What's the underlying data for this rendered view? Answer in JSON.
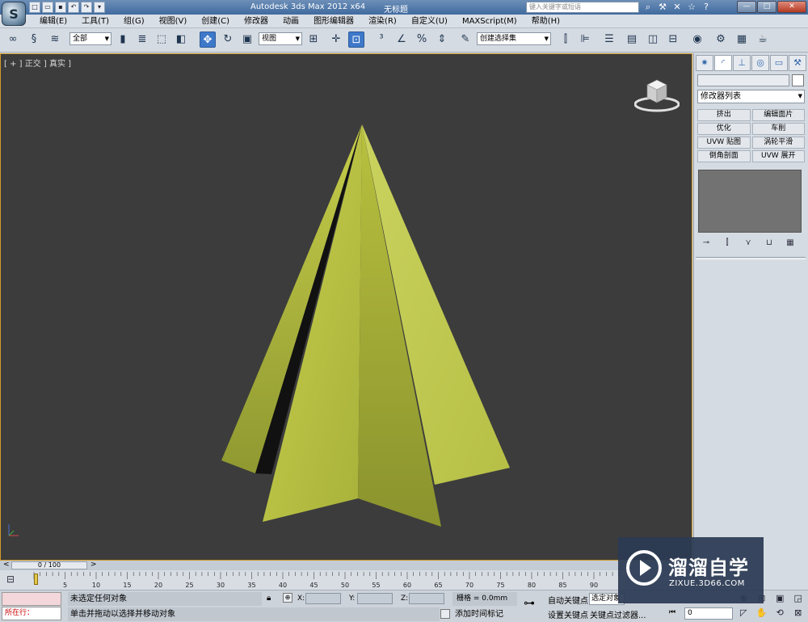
{
  "titlebar": {
    "app_title": "Autodesk 3ds Max  2012 x64",
    "doc_title": "无标题",
    "search_placeholder": "键入关键字或短语",
    "logo_letter": "S"
  },
  "menu": {
    "items": [
      "编辑(E)",
      "工具(T)",
      "组(G)",
      "视图(V)",
      "创建(C)",
      "修改器",
      "动画",
      "图形编辑器",
      "渲染(R)",
      "自定义(U)",
      "MAXScript(M)",
      "帮助(H)"
    ]
  },
  "toolbar": {
    "selection_filter": "全部",
    "ref_coord": "视图",
    "named_selection": "创建选择集"
  },
  "viewport": {
    "label": "[ + ] 正交 ] 真实 ]",
    "object_color": "#b5be3c"
  },
  "command_panel": {
    "modifier_list": "修改器列表",
    "modifier_buttons": [
      "挤出",
      "编辑面片",
      "优化",
      "车削",
      "UVW 贴图",
      "涡轮平滑",
      "倒角剖面",
      "UVW 展开"
    ]
  },
  "timeline": {
    "frame_display": "0 / 100",
    "ticks": [
      5,
      10,
      15,
      20,
      25,
      30,
      35,
      40,
      45,
      50,
      55,
      60,
      65,
      70,
      75,
      80,
      85,
      90
    ],
    "current_frame": 0,
    "total_frames": 100
  },
  "status": {
    "maxscript_label": "所在行：",
    "selection": "未选定任何对象",
    "prompt": "单击并拖动以选择并移动对象",
    "x_label": "X:",
    "y_label": "Y:",
    "z_label": "Z:",
    "grid": "栅格 = 0.0mm",
    "add_time_tag": "添加时间标记",
    "auto_key": "自动关键点",
    "set_key": "设置关键点",
    "key_mode": "选定对象",
    "key_filters": "关键点过滤器...",
    "frame_value": "0"
  },
  "watermark": {
    "title": "溜溜自学",
    "url": "ZIXUE.3D66.COM"
  }
}
